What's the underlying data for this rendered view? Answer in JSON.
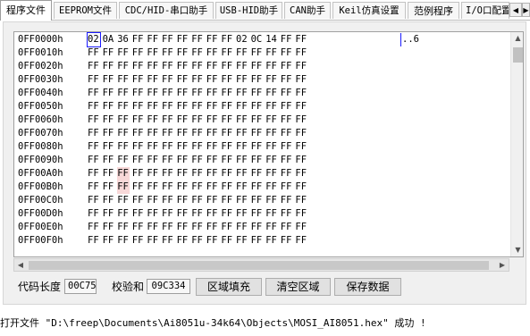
{
  "tabs": [
    {
      "label": "程序文件",
      "active": true
    },
    {
      "label": "EEPROM文件"
    },
    {
      "label": "CDC/HID-串口助手"
    },
    {
      "label": "USB-HID助手"
    },
    {
      "label": "CAN助手"
    },
    {
      "label": "Keil仿真设置"
    },
    {
      "label": "范例程序"
    },
    {
      "label": "I/O口配置"
    }
  ],
  "tab_nav": {
    "prev": "◀",
    "next": "▶"
  },
  "hex_view": {
    "rows": [
      {
        "address": "0FF0000h",
        "bytes": [
          "02",
          "0A",
          "36",
          "FF",
          "FF",
          "FF",
          "FF",
          "FF",
          "FF",
          "FF",
          "02",
          "0C",
          "14",
          "FF",
          "FF"
        ],
        "ascii": "..6"
      },
      {
        "address": "0FF0010h",
        "bytes": [
          "FF",
          "FF",
          "FF",
          "FF",
          "FF",
          "FF",
          "FF",
          "FF",
          "FF",
          "FF",
          "FF",
          "FF",
          "FF",
          "FF",
          "FF"
        ],
        "ascii": ""
      },
      {
        "address": "0FF0020h",
        "bytes": [
          "FF",
          "FF",
          "FF",
          "FF",
          "FF",
          "FF",
          "FF",
          "FF",
          "FF",
          "FF",
          "FF",
          "FF",
          "FF",
          "FF",
          "FF"
        ],
        "ascii": ""
      },
      {
        "address": "0FF0030h",
        "bytes": [
          "FF",
          "FF",
          "FF",
          "FF",
          "FF",
          "FF",
          "FF",
          "FF",
          "FF",
          "FF",
          "FF",
          "FF",
          "FF",
          "FF",
          "FF"
        ],
        "ascii": ""
      },
      {
        "address": "0FF0040h",
        "bytes": [
          "FF",
          "FF",
          "FF",
          "FF",
          "FF",
          "FF",
          "FF",
          "FF",
          "FF",
          "FF",
          "FF",
          "FF",
          "FF",
          "FF",
          "FF"
        ],
        "ascii": ""
      },
      {
        "address": "0FF0050h",
        "bytes": [
          "FF",
          "FF",
          "FF",
          "FF",
          "FF",
          "FF",
          "FF",
          "FF",
          "FF",
          "FF",
          "FF",
          "FF",
          "FF",
          "FF",
          "FF"
        ],
        "ascii": ""
      },
      {
        "address": "0FF0060h",
        "bytes": [
          "FF",
          "FF",
          "FF",
          "FF",
          "FF",
          "FF",
          "FF",
          "FF",
          "FF",
          "FF",
          "FF",
          "FF",
          "FF",
          "FF",
          "FF"
        ],
        "ascii": ""
      },
      {
        "address": "0FF0070h",
        "bytes": [
          "FF",
          "FF",
          "FF",
          "FF",
          "FF",
          "FF",
          "FF",
          "FF",
          "FF",
          "FF",
          "FF",
          "FF",
          "FF",
          "FF",
          "FF"
        ],
        "ascii": ""
      },
      {
        "address": "0FF0080h",
        "bytes": [
          "FF",
          "FF",
          "FF",
          "FF",
          "FF",
          "FF",
          "FF",
          "FF",
          "FF",
          "FF",
          "FF",
          "FF",
          "FF",
          "FF",
          "FF"
        ],
        "ascii": ""
      },
      {
        "address": "0FF0090h",
        "bytes": [
          "FF",
          "FF",
          "FF",
          "FF",
          "FF",
          "FF",
          "FF",
          "FF",
          "FF",
          "FF",
          "FF",
          "FF",
          "FF",
          "FF",
          "FF"
        ],
        "ascii": ""
      },
      {
        "address": "0FF00A0h",
        "bytes": [
          "FF",
          "FF",
          "FF",
          "FF",
          "FF",
          "FF",
          "FF",
          "FF",
          "FF",
          "FF",
          "FF",
          "FF",
          "FF",
          "FF",
          "FF"
        ],
        "ascii": ""
      },
      {
        "address": "0FF00B0h",
        "bytes": [
          "FF",
          "FF",
          "FF",
          "FF",
          "FF",
          "FF",
          "FF",
          "FF",
          "FF",
          "FF",
          "FF",
          "FF",
          "FF",
          "FF",
          "FF"
        ],
        "ascii": ""
      },
      {
        "address": "0FF00C0h",
        "bytes": [
          "FF",
          "FF",
          "FF",
          "FF",
          "FF",
          "FF",
          "FF",
          "FF",
          "FF",
          "FF",
          "FF",
          "FF",
          "FF",
          "FF",
          "FF"
        ],
        "ascii": ""
      },
      {
        "address": "0FF00D0h",
        "bytes": [
          "FF",
          "FF",
          "FF",
          "FF",
          "FF",
          "FF",
          "FF",
          "FF",
          "FF",
          "FF",
          "FF",
          "FF",
          "FF",
          "FF",
          "FF"
        ],
        "ascii": ""
      },
      {
        "address": "0FF00E0h",
        "bytes": [
          "FF",
          "FF",
          "FF",
          "FF",
          "FF",
          "FF",
          "FF",
          "FF",
          "FF",
          "FF",
          "FF",
          "FF",
          "FF",
          "FF",
          "FF"
        ],
        "ascii": ""
      },
      {
        "address": "0FF00F0h",
        "bytes": [
          "FF",
          "FF",
          "FF",
          "FF",
          "FF",
          "FF",
          "FF",
          "FF",
          "FF",
          "FF",
          "FF",
          "FF",
          "FF",
          "FF",
          "FF"
        ],
        "ascii": ""
      }
    ]
  },
  "scrollbar": {
    "up": "▲",
    "down": "▼",
    "left": "◀",
    "right": "▶"
  },
  "footer": {
    "checksum_code_label": "代码长度",
    "checksum_code_value": "00C75",
    "checksum_label": "校验和",
    "checksum_value": "09C334",
    "fill_button": "区域填充",
    "clear_button": "清空区域",
    "save_button": "保存数据"
  },
  "status": "打开文件 \"D:\\freep\\Documents\\Ai8051u-34k64\\Objects\\MOSI_AI8051.hex\" 成功 !",
  "colors": {
    "cursor": "#1a1aff",
    "highlight": "#f8d8d8"
  }
}
